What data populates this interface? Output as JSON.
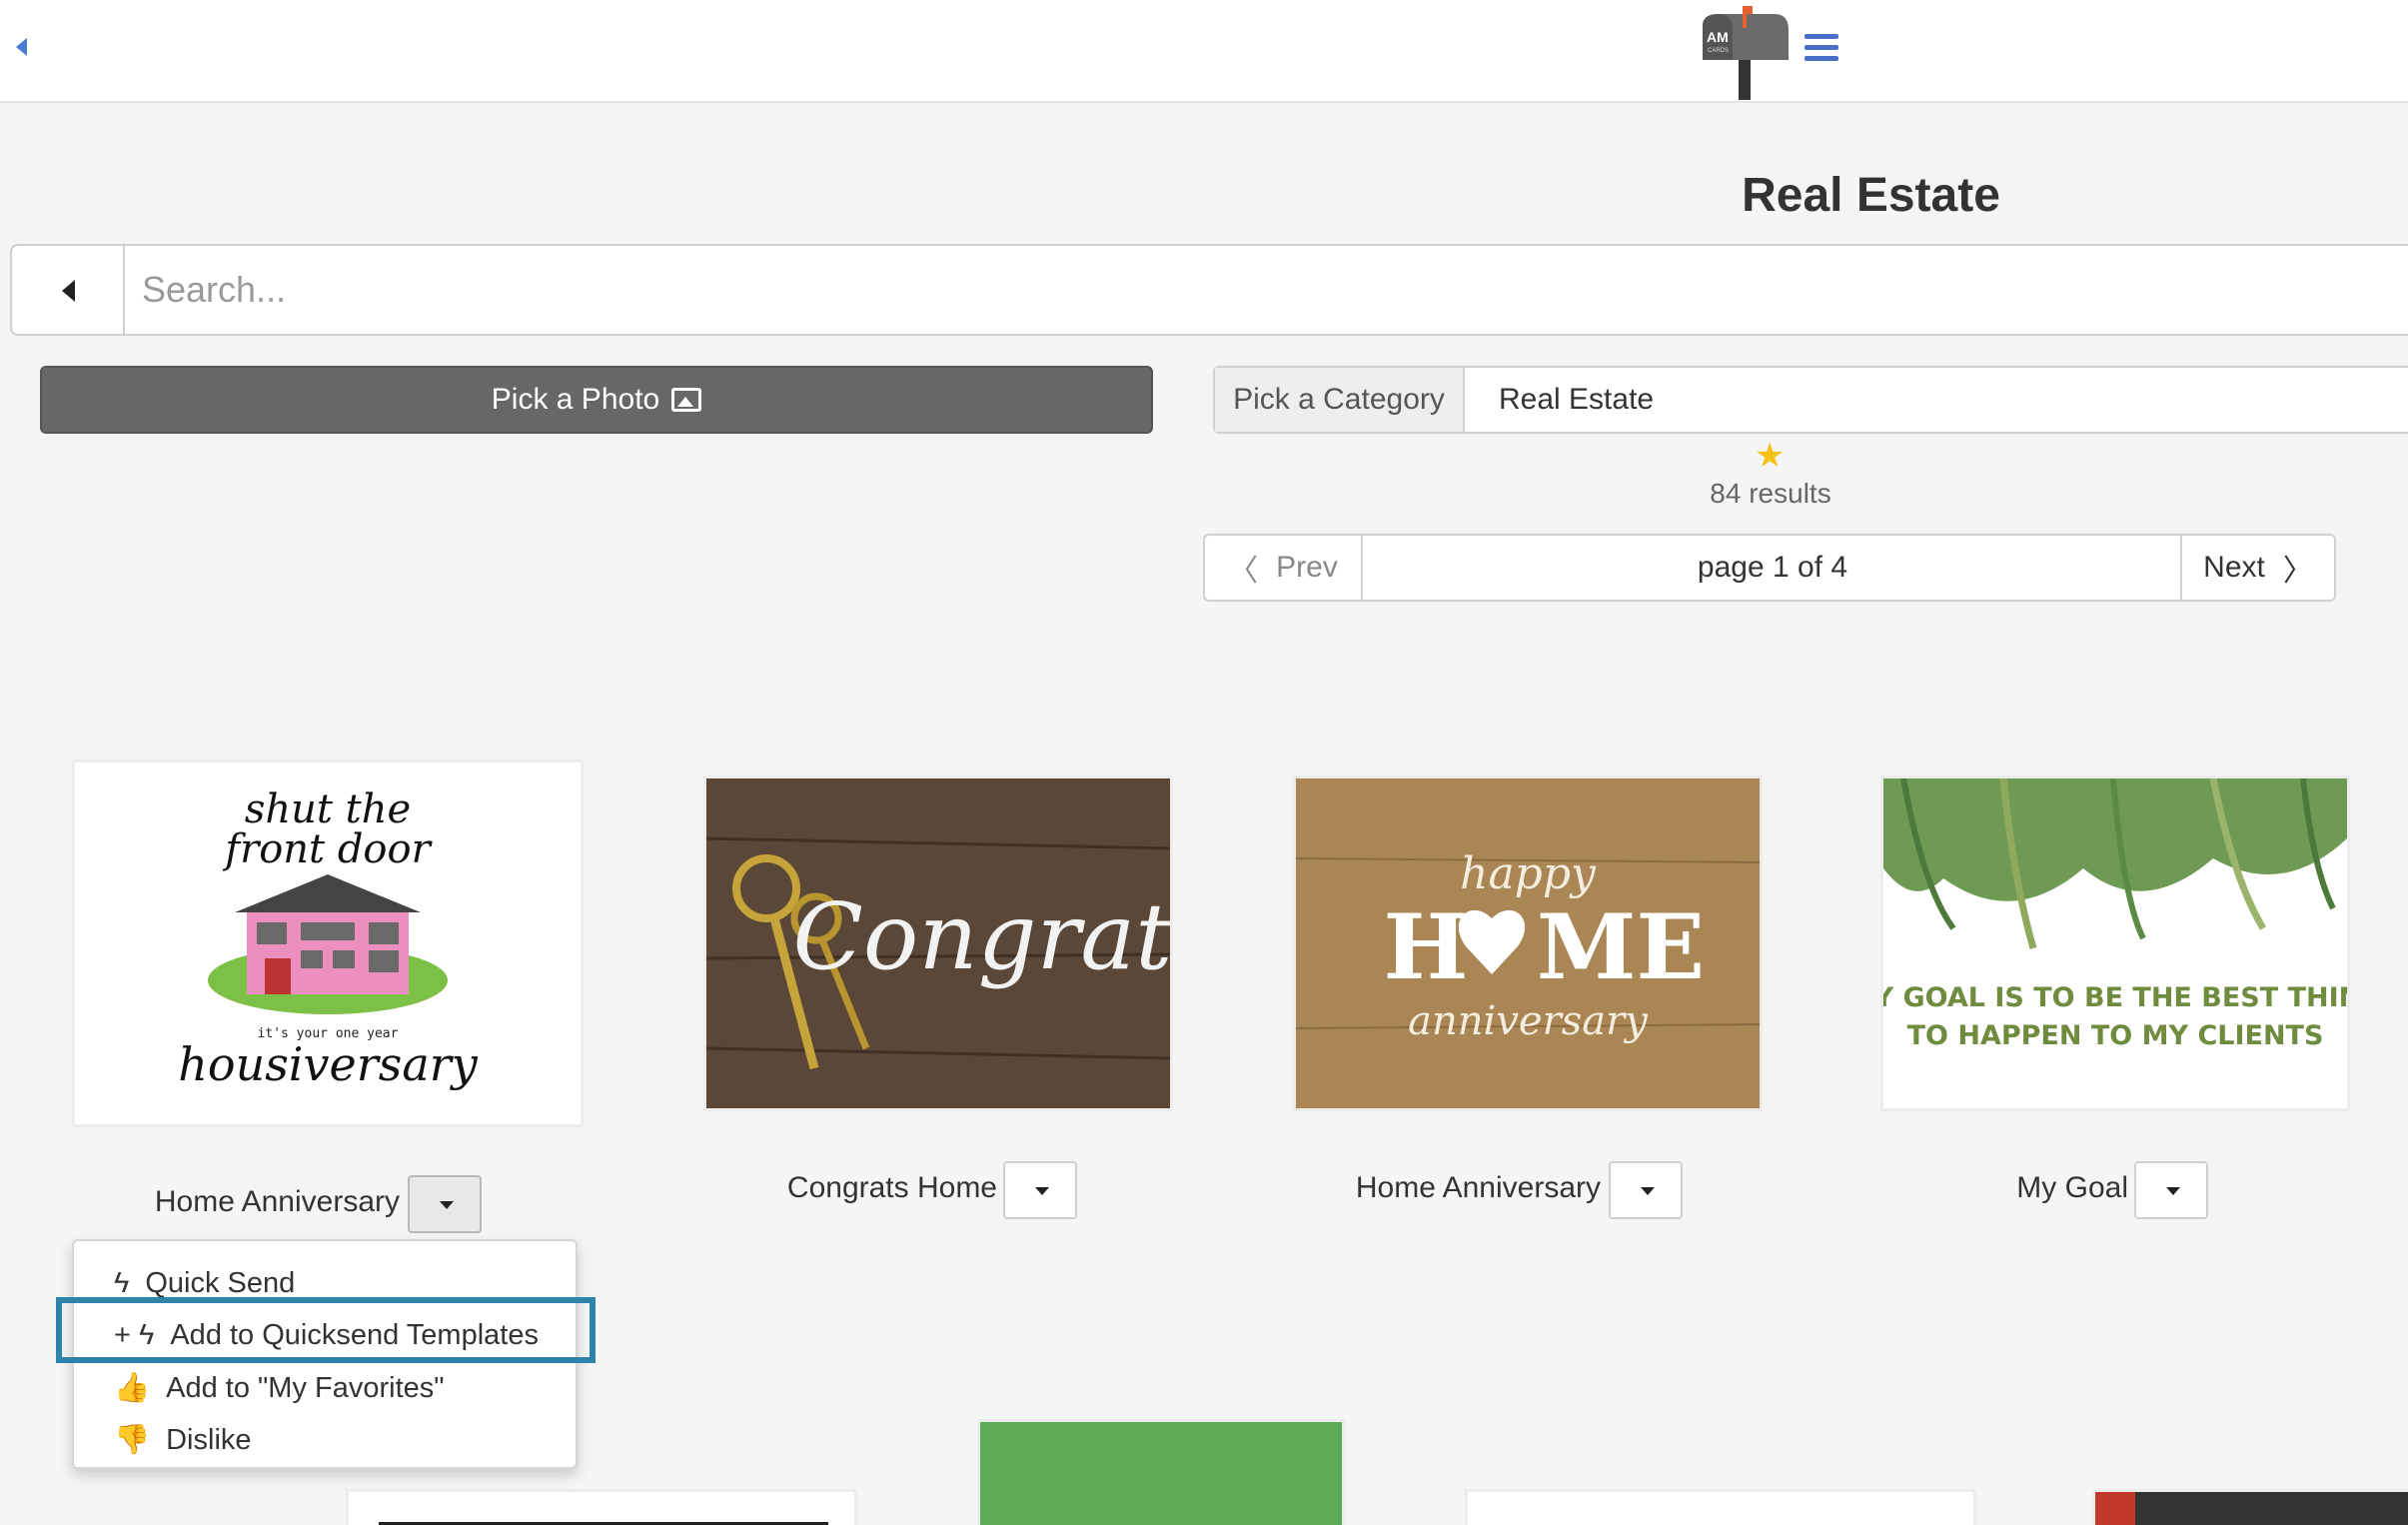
{
  "header": {
    "logo_icon": "mailbox-logo-icon",
    "logo_text": "AM",
    "logo_subtext": "CARDS",
    "menu_icon": "hamburger-menu-icon",
    "back_icon": "caret-left-icon",
    "accent_color": "#4a6fc9"
  },
  "page": {
    "title": "Real Estate"
  },
  "search": {
    "placeholder": "Search...",
    "value": ""
  },
  "pick_photo": {
    "label": "Pick a Photo",
    "icon": "image-icon",
    "bg_color": "#676767"
  },
  "category": {
    "label": "Pick a Category",
    "value": "Real Estate"
  },
  "favorites": {
    "icon": "star-icon",
    "color": "#f4c21a"
  },
  "results": {
    "text": "84 results"
  },
  "pager": {
    "prev": "Prev",
    "page": "page 1 of 4",
    "next": "Next"
  },
  "cards": [
    {
      "label": "Home Anniversary",
      "art": {
        "line1": "shut the",
        "line2": "front door",
        "line3": "it's your one year",
        "line4": "housiversary"
      }
    },
    {
      "label": "Congrats Home",
      "art": {
        "text": "Congrats"
      }
    },
    {
      "label": "Home Anniversary",
      "art": {
        "line1": "happy",
        "line2": "H",
        "line3": "ME",
        "line4": "anniversary"
      }
    },
    {
      "label": "My Goal",
      "art": {
        "line1": "MY GOAL IS TO BE THE BEST THING",
        "line2": "TO HAPPEN TO MY CLIENTS"
      }
    }
  ],
  "dropdown": {
    "items": [
      {
        "label": "Quick Send",
        "icon": "bolt-icon"
      },
      {
        "label": "Add to Quicksend Templates",
        "icon": "plus-bolt-icon"
      },
      {
        "label": "Add to \"My Favorites\"",
        "icon": "thumbs-up-icon"
      },
      {
        "label": "Dislike",
        "icon": "thumbs-down-icon"
      }
    ],
    "highlight_color": "#2f83a8"
  }
}
